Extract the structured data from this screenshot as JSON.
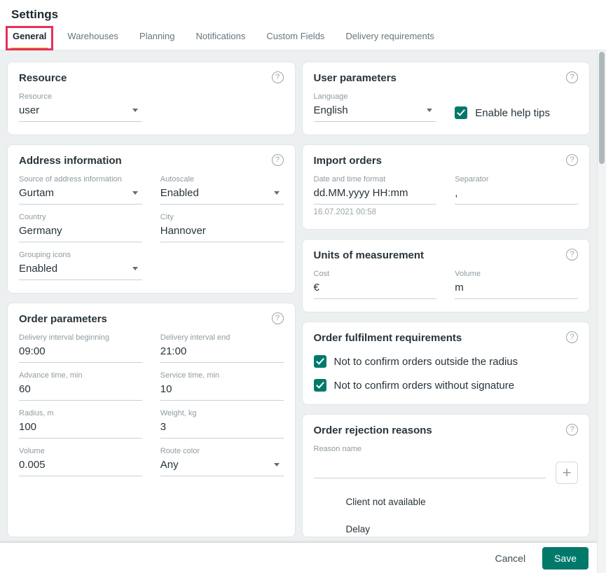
{
  "page": {
    "title": "Settings"
  },
  "tabs": [
    {
      "label": "General",
      "active": true
    },
    {
      "label": "Warehouses"
    },
    {
      "label": "Planning"
    },
    {
      "label": "Notifications"
    },
    {
      "label": "Custom Fields"
    },
    {
      "label": "Delivery requirements"
    }
  ],
  "icons": {
    "help": "?",
    "plus": "+"
  },
  "cards": {
    "resource": {
      "title": "Resource",
      "field": {
        "label": "Resource",
        "value": "user"
      }
    },
    "user_parameters": {
      "title": "User parameters",
      "language": {
        "label": "Language",
        "value": "English"
      },
      "enable_help_tips": {
        "label": "Enable help tips",
        "checked": true
      }
    },
    "address_information": {
      "title": "Address information",
      "source": {
        "label": "Source of address information",
        "value": "Gurtam"
      },
      "autoscale": {
        "label": "Autoscale",
        "value": "Enabled"
      },
      "country": {
        "label": "Country",
        "value": "Germany"
      },
      "city": {
        "label": "City",
        "value": "Hannover"
      },
      "grouping_icons": {
        "label": "Grouping icons",
        "value": "Enabled"
      }
    },
    "import_orders": {
      "title": "Import orders",
      "date_format": {
        "label": "Date and time format",
        "value": "dd.MM.yyyy HH:mm",
        "hint": "16.07.2021 00:58"
      },
      "separator": {
        "label": "Separator",
        "value": ","
      }
    },
    "units_of_measurement": {
      "title": "Units of measurement",
      "cost": {
        "label": "Cost",
        "value": "€"
      },
      "volume": {
        "label": "Volume",
        "value": "m"
      }
    },
    "order_parameters": {
      "title": "Order parameters",
      "delivery_interval_beginning": {
        "label": "Delivery interval beginning",
        "value": "09:00"
      },
      "delivery_interval_end": {
        "label": "Delivery interval end",
        "value": "21:00"
      },
      "advance_time": {
        "label": "Advance time, min",
        "value": "60"
      },
      "service_time": {
        "label": "Service time, min",
        "value": "10"
      },
      "radius": {
        "label": "Radius, m",
        "value": "100"
      },
      "weight": {
        "label": "Weight, kg",
        "value": "3"
      },
      "volume": {
        "label": "Volume",
        "value": "0.005"
      },
      "route_color": {
        "label": "Route color",
        "value": "Any"
      }
    },
    "order_fulfilment_requirements": {
      "title": "Order fulfilment requirements",
      "options": [
        {
          "label": "Not to confirm orders outside the radius",
          "checked": true
        },
        {
          "label": "Not to confirm orders without signature",
          "checked": true
        }
      ]
    },
    "order_rejection_reasons": {
      "title": "Order rejection reasons",
      "reason_name": {
        "label": "Reason name",
        "value": ""
      },
      "reasons": [
        "Client not available",
        "Delay"
      ]
    }
  },
  "footer": {
    "cancel": "Cancel",
    "save": "Save"
  },
  "colors": {
    "accent": "#00796b",
    "tab_underline": "#ff9800",
    "annotation": "#e3325b",
    "content_background": "#edf0f1"
  }
}
